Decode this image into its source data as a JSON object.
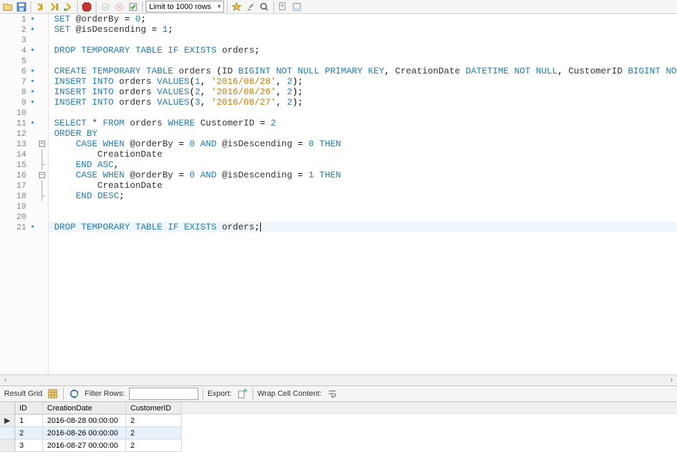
{
  "toolbar": {
    "limit_label": "Limit to 1000 rows"
  },
  "code": {
    "lines": [
      {
        "n": 1,
        "bp": true
      },
      {
        "n": 2,
        "bp": true
      },
      {
        "n": 3
      },
      {
        "n": 4,
        "bp": true
      },
      {
        "n": 5
      },
      {
        "n": 6,
        "bp": true
      },
      {
        "n": 7,
        "bp": true
      },
      {
        "n": 8,
        "bp": true
      },
      {
        "n": 9,
        "bp": true
      },
      {
        "n": 10
      },
      {
        "n": 11,
        "bp": true
      },
      {
        "n": 12
      },
      {
        "n": 13,
        "fold": "start"
      },
      {
        "n": 14,
        "fold": "mid"
      },
      {
        "n": 15,
        "fold": "end"
      },
      {
        "n": 16,
        "fold": "start"
      },
      {
        "n": 17,
        "fold": "mid"
      },
      {
        "n": 18,
        "fold": "end"
      },
      {
        "n": 19
      },
      {
        "n": 20
      },
      {
        "n": 21,
        "bp": true,
        "hl": true
      }
    ],
    "tokens": {
      "SET": "SET",
      "DROP": "DROP",
      "TEMPORARY": "TEMPORARY",
      "TABLE": "TABLE",
      "IF": "IF",
      "EXISTS": "EXISTS",
      "CREATE": "CREATE",
      "BIGINT": "BIGINT",
      "NOT": "NOT",
      "NULL": "NULL",
      "PRIMARY": "PRIMARY",
      "KEY": "KEY",
      "DATETIME": "DATETIME",
      "INSERT": "INSERT",
      "INTO": "INTO",
      "VALUES": "VALUES",
      "SELECT": "SELECT",
      "FROM": "FROM",
      "WHERE": "WHERE",
      "ORDER": "ORDER",
      "BY": "BY",
      "CASE": "CASE",
      "WHEN": "WHEN",
      "AND": "AND",
      "THEN": "THEN",
      "END": "END",
      "ASC": "ASC",
      "DESC": "DESC"
    },
    "idents": {
      "orders": "orders",
      "ID": "ID",
      "CreationDate": "CreationDate",
      "CustomerID": "CustomerID",
      "orderBy": "@orderBy",
      "isDescending": "@isDescending"
    },
    "values": {
      "zero": "0",
      "one": "1",
      "two": "2",
      "three": "3",
      "d1": "'2016/08/28'",
      "d2": "'2016/08/26'",
      "d3": "'2016/08/27'",
      "star": "*"
    }
  },
  "resultbar": {
    "grid_label": "Result Grid",
    "filter_label": "Filter Rows:",
    "export_label": "Export:",
    "wrap_label": "Wrap Cell Content:"
  },
  "grid": {
    "headers": {
      "id": "ID",
      "date": "CreationDate",
      "cust": "CustomerID"
    },
    "rows": [
      {
        "mark": "▶",
        "id": "1",
        "date": "2016-08-28 00:00:00",
        "cust": "2"
      },
      {
        "mark": "",
        "id": "2",
        "date": "2016-08-26 00:00:00",
        "cust": "2",
        "selected": true
      },
      {
        "mark": "",
        "id": "3",
        "date": "2016-08-27 00:00:00",
        "cust": "2"
      }
    ]
  }
}
